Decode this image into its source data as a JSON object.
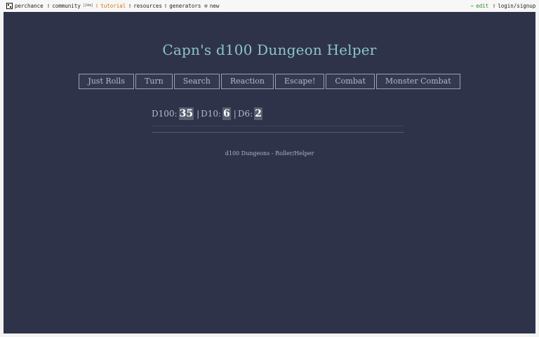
{
  "topbar": {
    "logo": "perchance",
    "community": "community",
    "community_badge": "[24m]",
    "tutorial": "tutorial",
    "resources": "resources",
    "generators": "generators",
    "new": "new",
    "edit": "edit",
    "login": "login/signup",
    "icons": {
      "logo": "dice-icon",
      "community": "chat-icon",
      "tutorial": "book-icon",
      "resources": "folder-icon",
      "generators": "list-icon",
      "new": "plus-circle-icon",
      "edit": "pencil-icon",
      "login": "user-icon"
    }
  },
  "app": {
    "title": "Capn's d100 Dungeon Helper",
    "buttons": [
      "Just Rolls",
      "Turn",
      "Search",
      "Reaction",
      "Escape!",
      "Combat",
      "Monster Combat"
    ],
    "rolls": {
      "d100_label": "D100:",
      "d100_value": "35",
      "d10_label": "D10:",
      "d10_value": "6",
      "d6_label": "D6:",
      "d6_value": "2",
      "separator": "|"
    },
    "footer": "d100 Dungeons - Roller/Helper"
  },
  "colors": {
    "background": "#2f3349",
    "title": "#8cc5cf",
    "tutorial": "#d9730d",
    "edit": "#2f8a2f"
  }
}
